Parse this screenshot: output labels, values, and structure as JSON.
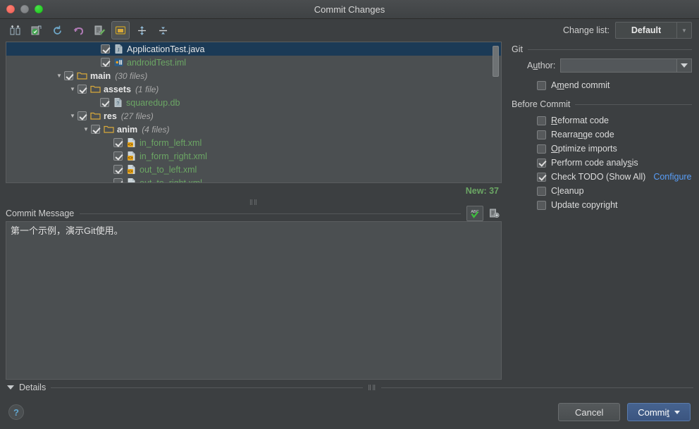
{
  "window": {
    "title": "Commit Changes",
    "traffic_lights": [
      "close-button",
      "minimize-button",
      "zoom-button"
    ]
  },
  "toolbar": {
    "icons": [
      {
        "name": "show-diff-icon",
        "label": "Show Diff"
      },
      {
        "name": "revert-icon",
        "label": "Revert"
      },
      {
        "name": "refresh-icon",
        "label": "Refresh"
      },
      {
        "name": "rollback-icon",
        "label": "Rollback"
      },
      {
        "name": "edit-source-icon",
        "label": "Edit Source"
      },
      {
        "name": "group-by-directory-icon",
        "label": "Group By Directory",
        "active": true
      },
      {
        "name": "expand-all-icon",
        "label": "Expand All"
      },
      {
        "name": "collapse-all-icon",
        "label": "Collapse All"
      }
    ],
    "change_list_label": "Change list:",
    "change_list_value": "Default"
  },
  "tree": {
    "rows": [
      {
        "indent": 0,
        "twisty": "",
        "checked": true,
        "icon": "java-file-icon",
        "name": "ApplicationTest.java",
        "count": "",
        "color": "white",
        "bold": false,
        "selected": true
      },
      {
        "indent": 0,
        "twisty": "",
        "checked": true,
        "icon": "iml-file-icon",
        "name": "androidTest.iml",
        "count": "",
        "color": "green",
        "bold": false,
        "selected": false
      },
      {
        "indent": 1,
        "twisty": "▼",
        "checked": true,
        "icon": "folder-icon",
        "name": "main",
        "count": "(30 files)",
        "color": "white",
        "bold": true,
        "selected": false
      },
      {
        "indent": 2,
        "twisty": "▼",
        "checked": true,
        "icon": "folder-icon",
        "name": "assets",
        "count": "(1 file)",
        "color": "white",
        "bold": true,
        "selected": false
      },
      {
        "indent": 3,
        "twisty": "",
        "checked": true,
        "icon": "db-file-icon",
        "name": "squaredup.db",
        "count": "",
        "color": "green",
        "bold": false,
        "selected": false
      },
      {
        "indent": 2,
        "twisty": "▼",
        "checked": true,
        "icon": "folder-icon",
        "name": "res",
        "count": "(27 files)",
        "color": "white",
        "bold": true,
        "selected": false
      },
      {
        "indent": 3,
        "twisty": "▼",
        "checked": true,
        "icon": "folder-icon",
        "name": "anim",
        "count": "(4 files)",
        "color": "white",
        "bold": true,
        "selected": false
      },
      {
        "indent": 4,
        "twisty": "",
        "checked": true,
        "icon": "xml-file-icon",
        "name": "in_form_left.xml",
        "count": "",
        "color": "green",
        "bold": false,
        "selected": false
      },
      {
        "indent": 4,
        "twisty": "",
        "checked": true,
        "icon": "xml-file-icon",
        "name": "in_form_right.xml",
        "count": "",
        "color": "green",
        "bold": false,
        "selected": false
      },
      {
        "indent": 4,
        "twisty": "",
        "checked": true,
        "icon": "xml-file-icon",
        "name": "out_to_left.xml",
        "count": "",
        "color": "green",
        "bold": false,
        "selected": false
      },
      {
        "indent": 4,
        "twisty": "",
        "checked": true,
        "icon": "xml-file-icon",
        "name": "out_to_right.xml",
        "count": "",
        "color": "green",
        "bold": false,
        "selected": false
      }
    ],
    "new_count": "New: 37"
  },
  "commit_message": {
    "title": "Commit Message",
    "text": "第一个示例，演示Git使用。",
    "spellcheck_icon": "spellcheck-abc-icon",
    "history_icon": "message-history-icon"
  },
  "git_panel": {
    "group_title": "Git",
    "author_label_pre": "A",
    "author_label_mnemonic": "u",
    "author_label_post": "thor:",
    "author_value": "",
    "amend": {
      "label_pre": "A",
      "mnemonic": "m",
      "label_post": "end commit",
      "checked": false
    }
  },
  "before_commit": {
    "group_title": "Before Commit",
    "items": [
      {
        "pre": "",
        "mnemonic": "R",
        "post": "eformat code",
        "checked": false,
        "link": ""
      },
      {
        "pre": "Rearra",
        "mnemonic": "n",
        "post": "ge code",
        "checked": false,
        "link": ""
      },
      {
        "pre": "",
        "mnemonic": "O",
        "post": "ptimize imports",
        "checked": false,
        "link": ""
      },
      {
        "pre": "Perform code analy",
        "mnemonic": "s",
        "post": "is",
        "checked": true,
        "link": ""
      },
      {
        "pre": "Check TODO (Show All)",
        "mnemonic": "",
        "post": "",
        "checked": true,
        "link": "Configure"
      },
      {
        "pre": "C",
        "mnemonic": "l",
        "post": "eanup",
        "checked": false,
        "link": ""
      },
      {
        "pre": "Update copyright",
        "mnemonic": "",
        "post": "",
        "checked": false,
        "link": ""
      }
    ]
  },
  "details": {
    "label": "Details",
    "expanded": true
  },
  "footer": {
    "help_glyph": "?",
    "cancel_label": "Cancel",
    "commit_pre": "Commi",
    "commit_mnemonic": "t",
    "commit_post": ""
  },
  "colors": {
    "accent_blue": "#589df6",
    "selection_blue": "#1b3a56",
    "new_green": "#6ba664",
    "dialog_bg": "#3c3f41",
    "field_bg": "#4b4f51",
    "primary_button": "#46638f"
  }
}
